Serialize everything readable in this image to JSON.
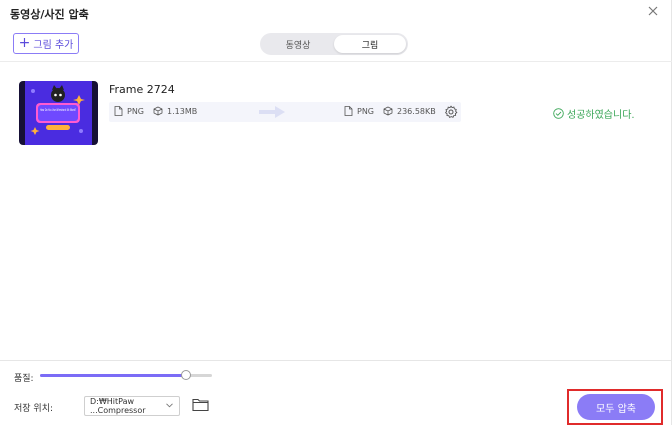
{
  "window": {
    "title": "동영상/사진 압축"
  },
  "toolbar": {
    "add_label": "그림 추가",
    "tabs": [
      {
        "label": "동영상"
      },
      {
        "label": "그림"
      }
    ]
  },
  "item": {
    "thumbnail_text": "How Do You Use Wireshark Kit Word?",
    "file_name": "Frame 2724",
    "input": {
      "format": "PNG",
      "size": "1.13MB"
    },
    "output": {
      "format": "PNG",
      "size": "236.58KB"
    },
    "status": "성공하였습니다."
  },
  "bottom": {
    "quality_label": "품질:",
    "quality_value": 0.85,
    "save_label": "저장 위치:",
    "save_path": "D:₩HitPaw ...Compressor",
    "compress_label": "모두 압축"
  },
  "colors": {
    "accent": "#8b7cf6",
    "success": "#3aa657",
    "highlight": "#e02b2b"
  }
}
